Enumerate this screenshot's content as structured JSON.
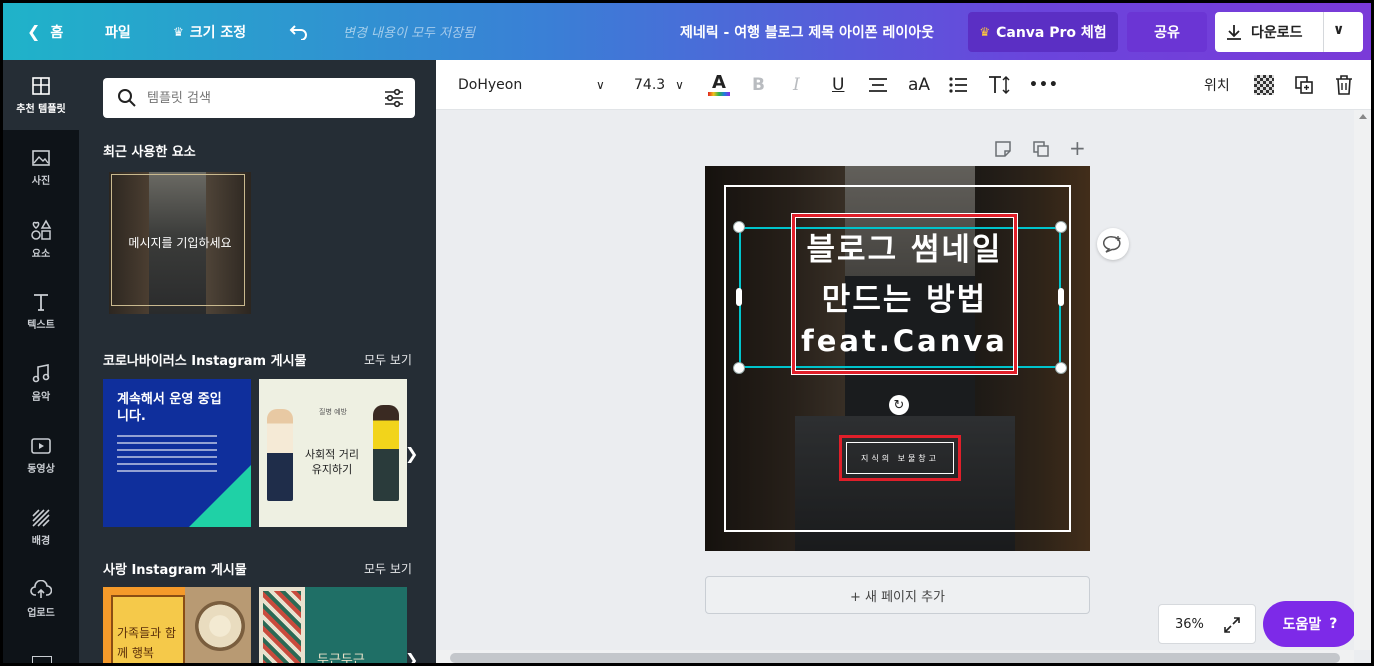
{
  "topbar": {
    "home": "홈",
    "file": "파일",
    "resize": "크기 조정",
    "saved_status": "변경 내용이 모두 저장됨",
    "doc_title": "제네릭 - 여행 블로그 제목 아이폰 레이아웃",
    "pro_trial": "Canva Pro 체험",
    "share": "공유",
    "download": "다운로드"
  },
  "rail": [
    {
      "label": "추천 템플릿",
      "icon": "template-icon"
    },
    {
      "label": "사진",
      "icon": "photo-icon"
    },
    {
      "label": "요소",
      "icon": "elements-icon"
    },
    {
      "label": "텍스트",
      "icon": "text-icon"
    },
    {
      "label": "음악",
      "icon": "music-icon"
    },
    {
      "label": "동영상",
      "icon": "video-icon"
    },
    {
      "label": "배경",
      "icon": "background-icon"
    },
    {
      "label": "업로드",
      "icon": "upload-icon"
    }
  ],
  "panel": {
    "search_placeholder": "템플릿 검색",
    "recent_title": "최근 사용한 요소",
    "recent_thumb_text": "메시지를 기입하세요",
    "corona_title": "코로나바이러스 Instagram 게시물",
    "corona_see_all": "모두 보기",
    "corona_t1_title": "계속해서 운영 중입니다.",
    "corona_t2_title": "사회적 거리 유지하기",
    "corona_t2_sub": "질병 예방",
    "love_title": "사랑 Instagram 게시물",
    "love_see_all": "모두 보기",
    "love_t1_text": "가족들과 함께 행복",
    "love_t3_text": "두근두근"
  },
  "toolbar": {
    "font": "DoHyeon",
    "size": "74.3",
    "bold": "B",
    "italic": "I",
    "underline": "U",
    "case": "aA",
    "more": "•••",
    "position": "위치"
  },
  "design": {
    "line1": "블로그 썸네일",
    "line2": "만드는 방법",
    "line3": "feat.Canva",
    "tag": "지식의 보물창고"
  },
  "canvas": {
    "add_page": "+ 새 페이지 추가",
    "zoom": "36%",
    "help": "도움말"
  },
  "colors": {
    "accent": "#7d2ae8",
    "selection": "#00c4cc",
    "highlight_box": "#e01f2a"
  }
}
